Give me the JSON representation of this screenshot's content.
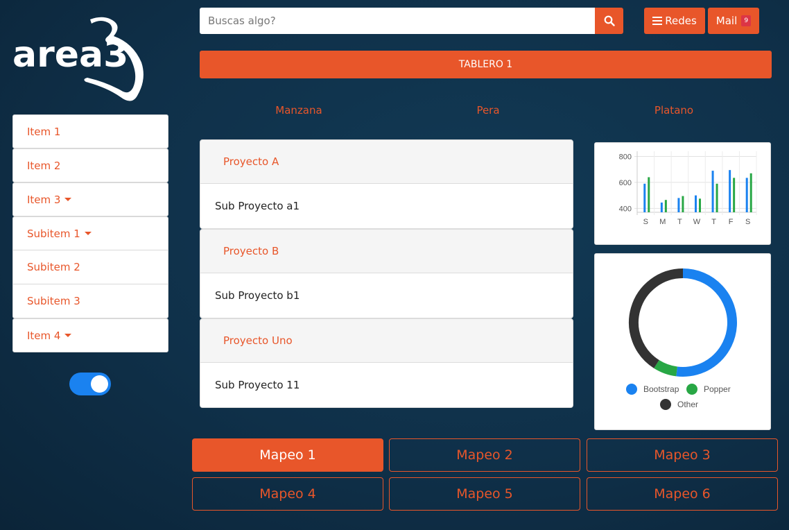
{
  "logo": {
    "text": "area3"
  },
  "sidebar": {
    "items": [
      {
        "label": "Item 1",
        "caret": false
      },
      {
        "label": "Item 2",
        "caret": false
      },
      {
        "label": "Item 3",
        "caret": true
      },
      {
        "label": "Subitem 1",
        "caret": true
      },
      {
        "label": "Subitem 2",
        "caret": false
      },
      {
        "label": "Subitem 3",
        "caret": false
      },
      {
        "label": "Item 4",
        "caret": true
      }
    ],
    "toggle_on": true
  },
  "search": {
    "placeholder": "Buscas algo?",
    "value": ""
  },
  "header": {
    "redes_label": "Redes",
    "mail_label": "Mail",
    "mail_badge": "9"
  },
  "tablero": {
    "label": "TABLERO 1"
  },
  "tabs": [
    "Manzana",
    "Pera",
    "Platano"
  ],
  "accordion": [
    {
      "title": "Proyecto A",
      "sub": "Sub Proyecto a1"
    },
    {
      "title": "Proyecto B",
      "sub": "Sub Proyecto b1"
    },
    {
      "title": "Proyecto Uno",
      "sub": "Sub Proyecto 11"
    }
  ],
  "mapeo": {
    "buttons": [
      "Mapeo 1",
      "Mapeo 2",
      "Mapeo 3",
      "Mapeo 4",
      "Mapeo 5",
      "Mapeo 6"
    ],
    "active_index": 0
  },
  "colors": {
    "accent": "#e8562a",
    "blue": "#1a82f0",
    "green": "#28a745",
    "dark": "#333333"
  },
  "chart_data": [
    {
      "type": "bar",
      "categories": [
        "S",
        "M",
        "T",
        "W",
        "T",
        "F",
        "S"
      ],
      "series": [
        {
          "values": [
            590,
            445,
            480,
            500,
            690,
            695,
            635
          ]
        },
        {
          "values": [
            640,
            465,
            495,
            475,
            590,
            635,
            670
          ]
        }
      ],
      "yticks": [
        "800",
        "600",
        "400"
      ],
      "ylim": [
        370,
        840
      ],
      "grid": true
    },
    {
      "type": "pie",
      "donut": true,
      "labels": [
        "Bootstrap",
        "Popper",
        "Other"
      ],
      "values": [
        52,
        7,
        41
      ],
      "legend": "bottom"
    }
  ]
}
